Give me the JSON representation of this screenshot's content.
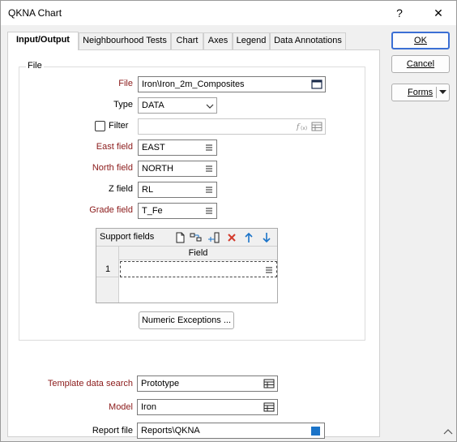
{
  "window": {
    "title": "QKNA Chart",
    "help_label": "?",
    "close_label": "✕"
  },
  "tabs": [
    {
      "label": "Input/Output",
      "active": true
    },
    {
      "label": "Neighbourhood Tests"
    },
    {
      "label": "Chart"
    },
    {
      "label": "Axes"
    },
    {
      "label": "Legend"
    },
    {
      "label": "Data Annotations"
    }
  ],
  "file_group": {
    "title": "File",
    "file": {
      "label": "File",
      "value": "Iron\\Iron_2m_Composites"
    },
    "type": {
      "label": "Type",
      "value": "DATA"
    },
    "filter": {
      "label": "Filter",
      "value": "",
      "checked": false
    },
    "east": {
      "label": "East field",
      "value": "EAST"
    },
    "north": {
      "label": "North field",
      "value": "NORTH"
    },
    "z": {
      "label": "Z field",
      "value": "RL"
    },
    "grade": {
      "label": "Grade field",
      "value": "T_Fe"
    },
    "support": {
      "title": "Support fields",
      "column_header": "Field",
      "rows": [
        {
          "num": "1",
          "value": ""
        }
      ]
    },
    "numeric_exceptions_label": "Numeric Exceptions ..."
  },
  "template": {
    "label": "Template data search",
    "value": "Prototype"
  },
  "model": {
    "label": "Model",
    "value": "Iron"
  },
  "report": {
    "label": "Report file",
    "value": "Reports\\QKNA"
  },
  "buttons": {
    "ok": "OK",
    "cancel": "Cancel",
    "forms": "Forms"
  },
  "colors": {
    "required_label": "#8b1a1a",
    "accent": "#1a73c8",
    "delete": "#d33b2c"
  }
}
